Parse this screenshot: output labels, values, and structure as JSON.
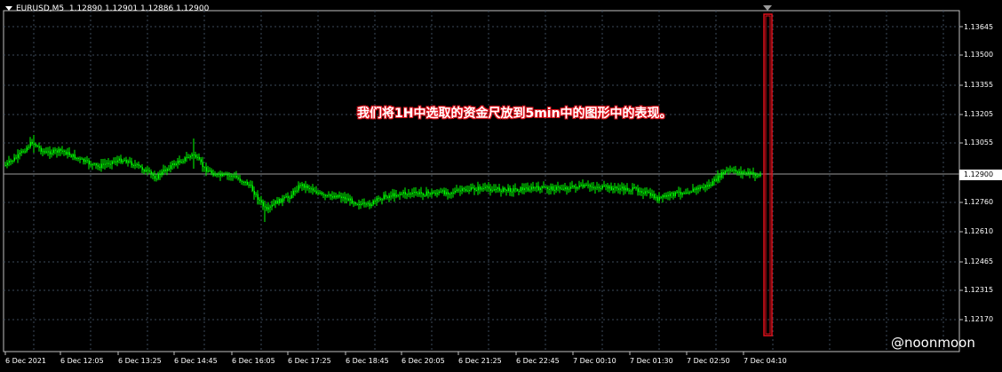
{
  "header": {
    "symbol_timeframe": "EURUSD,M5",
    "ohlc": "1.12890 1.12901 1.12886 1.12900"
  },
  "annotation_text": "我们将1H中选取的资金尺放到5min中的图形中的表现。",
  "price_axis": {
    "labels": [
      "1.13645",
      "1.13500",
      "1.13355",
      "1.13205",
      "1.13055",
      "1.12760",
      "1.12610",
      "1.12465",
      "1.12315",
      "1.12170"
    ],
    "current_price": "1.12900"
  },
  "time_axis": {
    "labels": [
      "6 Dec 2021",
      "6 Dec 12:05",
      "6 Dec 13:25",
      "6 Dec 14:45",
      "6 Dec 16:05",
      "6 Dec 17:25",
      "6 Dec 18:45",
      "6 Dec 20:05",
      "6 Dec 21:25",
      "6 Dec 22:45",
      "7 Dec 00:10",
      "7 Dec 01:30",
      "7 Dec 02:50",
      "7 Dec 04:10"
    ]
  },
  "colors": {
    "background": "#000000",
    "grid": "#3c4a5a",
    "candles": "#00ff00",
    "highlight_box": "#e0101a",
    "text": "#ffffff"
  },
  "watermark": "@noonmoon"
}
